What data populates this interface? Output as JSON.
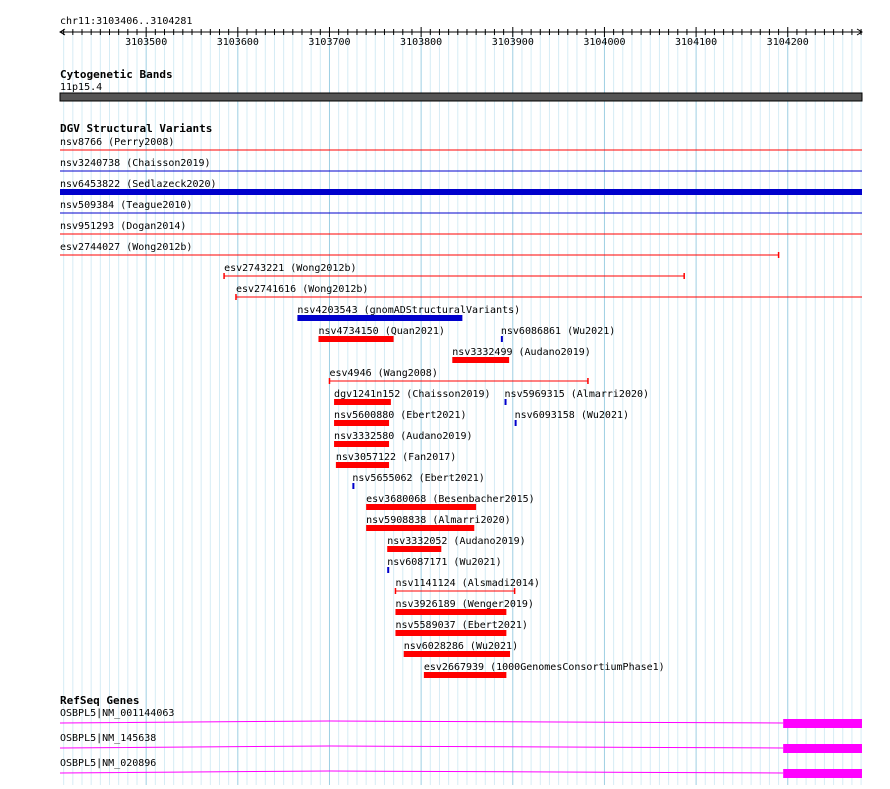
{
  "ruler": {
    "region_label": "chr11:3103406..3104281",
    "start": 3103406,
    "end": 3104281,
    "ticks": [
      "3103500",
      "3103600",
      "3103700",
      "3103800",
      "3103900",
      "3104000",
      "3104100",
      "3104200"
    ]
  },
  "cytoband": {
    "title": "Cytogenetic Bands",
    "band_label": "11p15.4",
    "color": "#555555"
  },
  "dgv": {
    "title": "DGV Structural Variants",
    "colors": {
      "loss": "#ff0000",
      "gain": "#0000cc"
    },
    "features": [
      {
        "label": "nsv8766 (Perry2008)",
        "start": 3103406,
        "end": 3104281,
        "type": "loss",
        "style": "thin"
      },
      {
        "label": "nsv3240738 (Chaisson2019)",
        "start": 3103406,
        "end": 3104281,
        "type": "gain",
        "style": "thin"
      },
      {
        "label": "nsv6453822 (Sedlazeck2020)",
        "start": 3103406,
        "end": 3104281,
        "type": "gain",
        "style": "thick"
      },
      {
        "label": "nsv509384 (Teague2010)",
        "start": 3103406,
        "end": 3104281,
        "type": "gain",
        "style": "thin"
      },
      {
        "label": "nsv951293 (Dogan2014)",
        "start": 3103406,
        "end": 3104281,
        "type": "loss",
        "style": "thin"
      },
      {
        "label": "esv2744027 (Wong2012b)",
        "start": 3103406,
        "end": 3104190,
        "type": "loss",
        "style": "capped"
      },
      {
        "label": "esv2743221 (Wong2012b)",
        "start": 3103585,
        "end": 3104087,
        "type": "loss",
        "style": "capped"
      },
      {
        "label": "esv2741616 (Wong2012b)",
        "start": 3103598,
        "end": 3104281,
        "type": "loss",
        "style": "capped"
      },
      {
        "label": "nsv4203543 (gnomADStructuralVariants)",
        "start": 3103665,
        "end": 3103845,
        "type": "gain",
        "style": "thick"
      },
      {
        "label": "nsv4734150 (Quan2021)",
        "start": 3103688,
        "end": 3103770,
        "type": "loss",
        "style": "thick"
      },
      {
        "label": "nsv3332499 (Audano2019)",
        "start": 3103834,
        "end": 3103896,
        "type": "loss",
        "style": "thick"
      },
      {
        "label": "esv4946 (Wang2008)",
        "start": 3103700,
        "end": 3103982,
        "type": "loss",
        "style": "capped"
      },
      {
        "label": "dgv1241n152 (Chaisson2019)",
        "start": 3103705,
        "end": 3103767,
        "type": "loss",
        "style": "thick"
      },
      {
        "label": "nsv6086861 (Wu2021)",
        "start": 3103887,
        "end": 3103889,
        "type": "gain",
        "style": "thick"
      },
      {
        "label": "nsv5600880 (Ebert2021)",
        "start": 3103705,
        "end": 3103765,
        "type": "loss",
        "style": "thick"
      },
      {
        "label": "nsv5969315 (Almarri2020)",
        "start": 3103891,
        "end": 3103893,
        "type": "gain",
        "style": "thick"
      },
      {
        "label": "nsv3332580 (Audano2019)",
        "start": 3103705,
        "end": 3103765,
        "type": "loss",
        "style": "thick"
      },
      {
        "label": "nsv6093158 (Wu2021)",
        "start": 3103902,
        "end": 3103904,
        "type": "gain",
        "style": "thick"
      },
      {
        "label": "nsv3057122 (Fan2017)",
        "start": 3103707,
        "end": 3103765,
        "type": "loss",
        "style": "thick"
      },
      {
        "label": "nsv5655062 (Ebert2021)",
        "start": 3103725,
        "end": 3103727,
        "type": "gain",
        "style": "thick"
      },
      {
        "label": "esv3680068 (Besenbacher2015)",
        "start": 3103740,
        "end": 3103860,
        "type": "loss",
        "style": "thick"
      },
      {
        "label": "nsv5908838 (Almarri2020)",
        "start": 3103740,
        "end": 3103858,
        "type": "loss",
        "style": "thick"
      },
      {
        "label": "nsv3332052 (Audano2019)",
        "start": 3103763,
        "end": 3103822,
        "type": "loss",
        "style": "thick"
      },
      {
        "label": "nsv6087171 (Wu2021)",
        "start": 3103763,
        "end": 3103765,
        "type": "gain",
        "style": "thick"
      },
      {
        "label": "nsv1141124 (Alsmadi2014)",
        "start": 3103772,
        "end": 3103902,
        "type": "loss",
        "style": "capped"
      },
      {
        "label": "nsv3926189 (Wenger2019)",
        "start": 3103772,
        "end": 3103893,
        "type": "loss",
        "style": "thick"
      },
      {
        "label": "nsv5589037 (Ebert2021)",
        "start": 3103772,
        "end": 3103893,
        "type": "loss",
        "style": "thick"
      },
      {
        "label": "nsv6028286 (Wu2021)",
        "start": 3103781,
        "end": 3103897,
        "type": "loss",
        "style": "thick"
      },
      {
        "label": "esv2667939 (1000GenomesConsortiumPhase1)",
        "start": 3103803,
        "end": 3103893,
        "type": "loss",
        "style": "thick"
      }
    ]
  },
  "refseq": {
    "title": "RefSeq Genes",
    "color": "#ff00ff",
    "genes": [
      {
        "label": "OSBPL5|NM_001144063",
        "exon_start": 3104195,
        "exon_end": 3104281
      },
      {
        "label": "OSBPL5|NM_145638",
        "exon_start": 3104195,
        "exon_end": 3104281
      },
      {
        "label": "OSBPL5|NM_020896",
        "exon_start": 3104195,
        "exon_end": 3104281
      }
    ]
  }
}
